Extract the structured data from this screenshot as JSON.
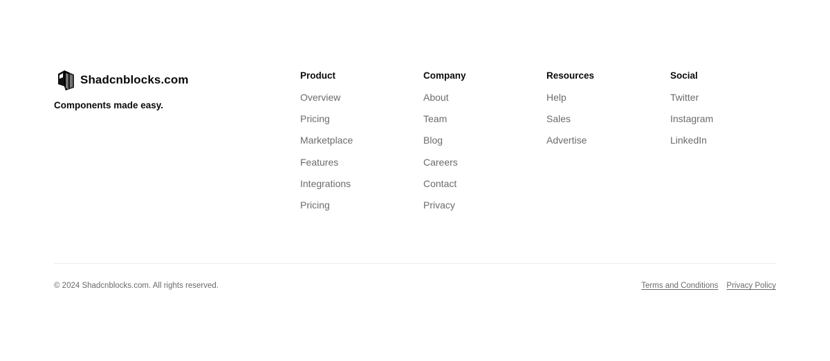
{
  "brand": {
    "logo_icon": "shadcnblocks-logo-icon",
    "name": "Shadcnblocks.com",
    "tagline": "Components made easy."
  },
  "columns": [
    {
      "title": "Product",
      "links": [
        "Overview",
        "Pricing",
        "Marketplace",
        "Features",
        "Integrations",
        "Pricing"
      ]
    },
    {
      "title": "Company",
      "links": [
        "About",
        "Team",
        "Blog",
        "Careers",
        "Contact",
        "Privacy"
      ]
    },
    {
      "title": "Resources",
      "links": [
        "Help",
        "Sales",
        "Advertise"
      ]
    },
    {
      "title": "Social",
      "links": [
        "Twitter",
        "Instagram",
        "LinkedIn"
      ]
    }
  ],
  "bottom": {
    "copyright": "© 2024 Shadcnblocks.com. All rights reserved.",
    "legal_links": [
      "Terms and Conditions",
      "Privacy Policy"
    ]
  },
  "colors": {
    "text_primary": "#0a0a0a",
    "text_muted": "#6b6b6b",
    "divider": "#ebebeb",
    "background": "#ffffff"
  }
}
